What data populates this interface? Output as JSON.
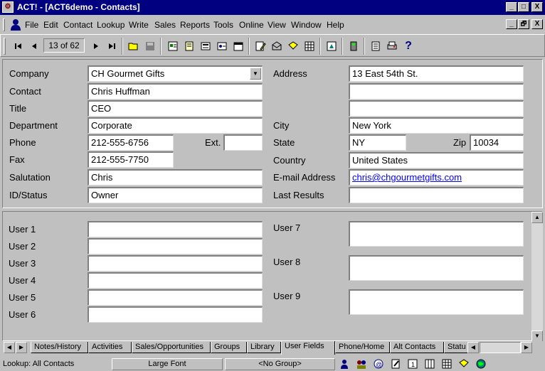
{
  "window": {
    "title": "ACT! - [ACT6demo - Contacts]",
    "minimize": "_",
    "maximize": "□",
    "close": "X",
    "child_minimize": "_",
    "child_restore": "🗗",
    "child_close": "X"
  },
  "menu": [
    "File",
    "Edit",
    "Contact",
    "Lookup",
    "Write",
    "Sales",
    "Reports",
    "Tools",
    "Online",
    "View",
    "Window",
    "Help"
  ],
  "toolbar": {
    "record_counter": "13 of 62"
  },
  "contact": {
    "labels": {
      "company": "Company",
      "contact": "Contact",
      "title": "Title",
      "department": "Department",
      "phone": "Phone",
      "ext": "Ext.",
      "fax": "Fax",
      "salutation": "Salutation",
      "id_status": "ID/Status",
      "address": "Address",
      "city": "City",
      "state": "State",
      "zip": "Zip",
      "country": "Country",
      "email": "E-mail Address",
      "last_results": "Last Results"
    },
    "values": {
      "company": "CH Gourmet Gifts",
      "contact": "Chris Huffman",
      "title": "CEO",
      "department": "Corporate",
      "phone": "212-555-6756",
      "ext": "",
      "fax": "212-555-7750",
      "salutation": "Chris",
      "id_status": "Owner",
      "address1": "13 East 54th St.",
      "address2": "",
      "address3": "",
      "city": "New York",
      "state": "NY",
      "zip": "10034",
      "country": "United States",
      "email": "chris@chgourmetgifts.com",
      "last_results": ""
    }
  },
  "user_fields": {
    "labels": [
      "User 1",
      "User 2",
      "User 3",
      "User 4",
      "User 5",
      "User 6",
      "User 7",
      "User 8",
      "User 9"
    ],
    "values": [
      "",
      "",
      "",
      "",
      "",
      "",
      "",
      "",
      ""
    ]
  },
  "tabs": [
    "Notes/History",
    "Activities",
    "Sales/Opportunities",
    "Groups",
    "Library",
    "User Fields",
    "Phone/Home",
    "Alt Contacts",
    "Statu"
  ],
  "active_tab": "User Fields",
  "status": {
    "lookup": "Lookup: All Contacts",
    "font": "Large Font",
    "group": "<No Group>"
  }
}
